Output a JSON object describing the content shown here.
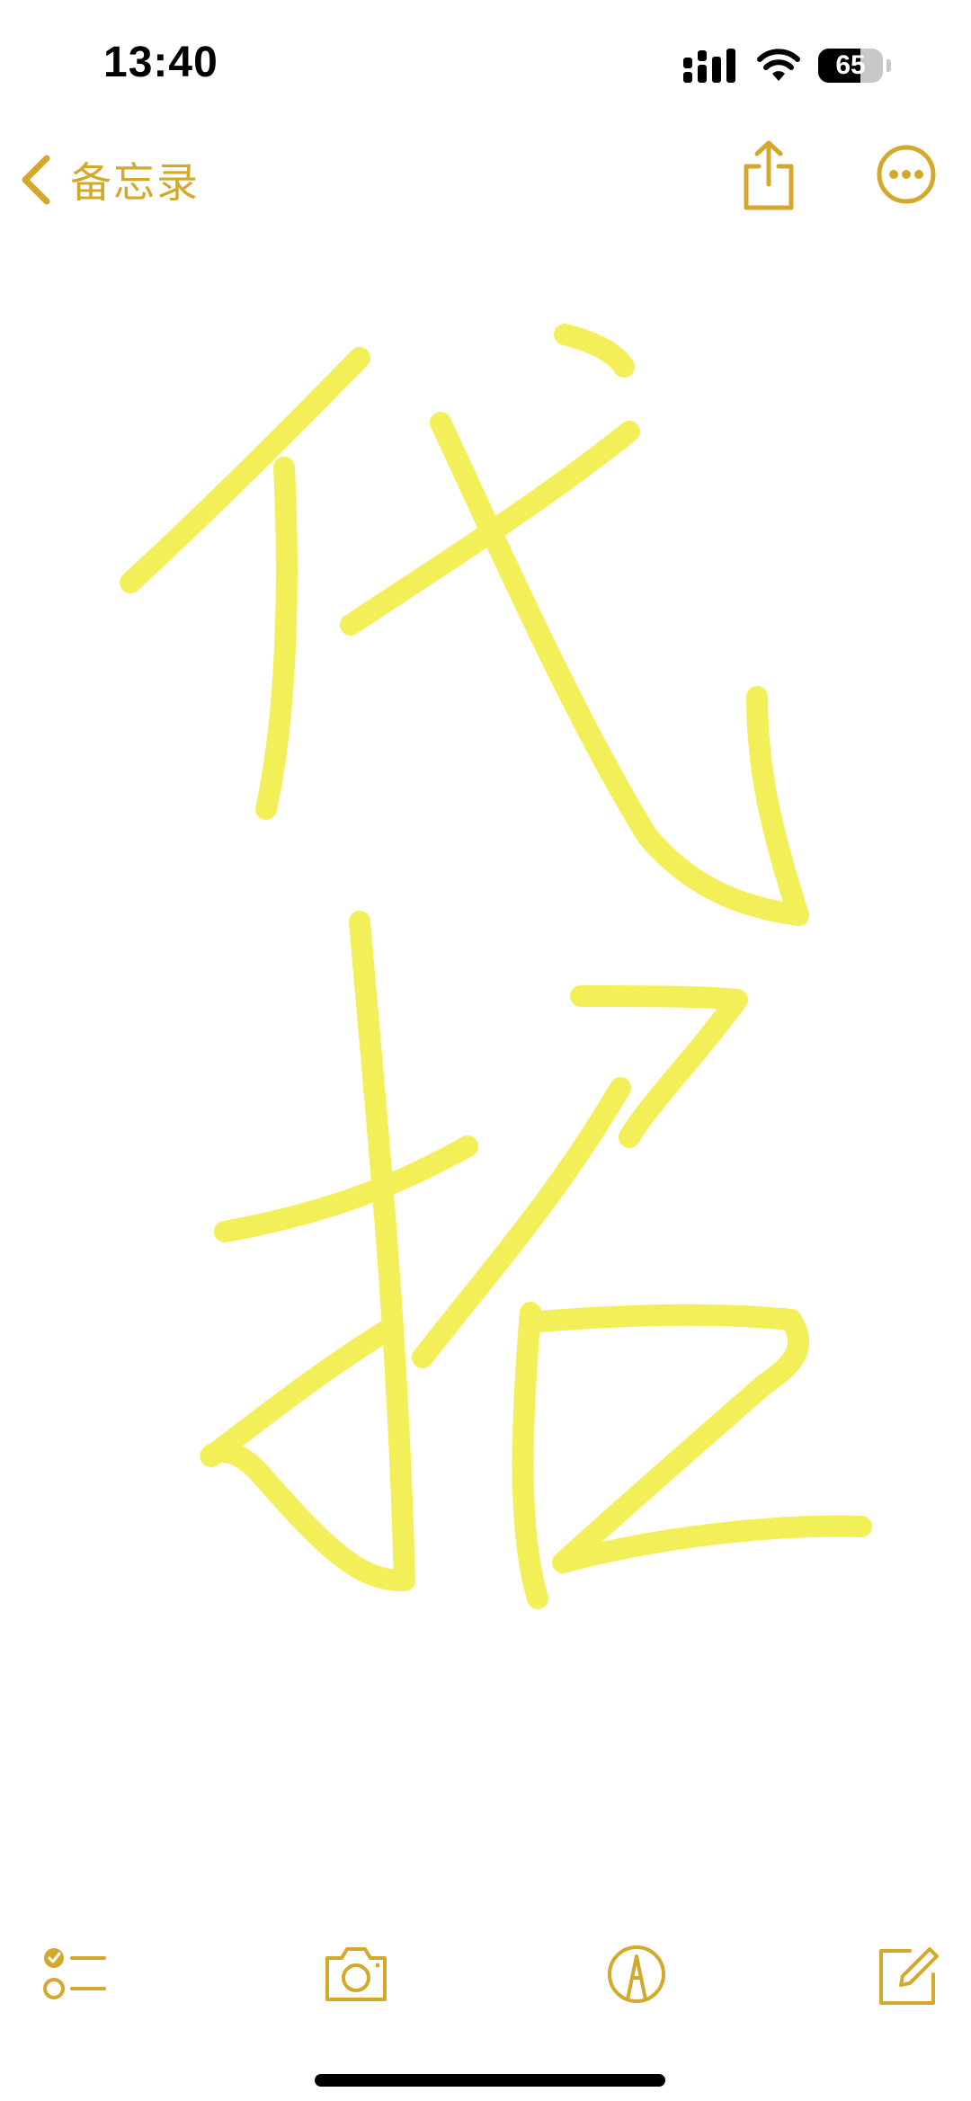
{
  "status_bar": {
    "time": "13:40",
    "battery_percent": 65,
    "battery_label": "65",
    "signal_icon": "cellular-signal-icon",
    "wifi_icon": "wifi-icon"
  },
  "nav": {
    "back_label": "备忘录",
    "back_icon": "chevron-left-icon",
    "share_icon": "share-icon",
    "more_icon": "more-ellipsis-icon"
  },
  "note": {
    "handwriting_text": "代招",
    "ink_color": "#F2EE4A"
  },
  "toolbar": {
    "checklist_icon": "checklist-icon",
    "camera_icon": "camera-icon",
    "markup_icon": "markup-pen-icon",
    "compose_icon": "compose-icon"
  },
  "colors": {
    "accent": "#D4A82A",
    "background": "#FFFFFF"
  }
}
